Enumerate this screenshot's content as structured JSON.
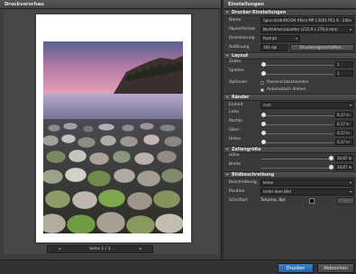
{
  "preview": {
    "title": "Druckvorschau",
    "pager": {
      "prev": "◂",
      "label": "Seite 1 / 1",
      "next": "▸"
    }
  },
  "settings": {
    "title": "Einstellungen",
    "printer_section": {
      "title": "Drucker-Einstellungen",
      "name_label": "Name",
      "name_value": "\\\\pcs-drsdr\\RICOH Aficio MP C3001 PCL 6 - 240",
      "paper_label": "Papierformat",
      "paper_value": "NorthAmericaLetter (215,9 x 279,4 mm)",
      "orientation_label": "Orientierung",
      "orientation_value": "Portrait",
      "resolution_label": "Auflösung",
      "resolution_value": "300 dpi",
      "properties_button": "Druckereigenschaften..."
    },
    "layout_section": {
      "title": "Layout",
      "rows_label": "Zeilen",
      "rows_value": "1",
      "cols_label": "Spalten",
      "cols_value": "1",
      "fit_label": "Optionen",
      "fit_checkbox": "Passend beschneiden",
      "auto_checkbox": "Automatisch drehen"
    },
    "margins_section": {
      "title": "Ränder",
      "unit_label": "Einheit",
      "unit_value": "inch",
      "left_label": "Links",
      "left_value": "0,17 in",
      "right_label": "Rechts",
      "right_value": "0,17 in",
      "top_label": "Oben",
      "top_value": "0,17 in",
      "bottom_label": "Unten",
      "bottom_value": "0,17 in"
    },
    "cell_section": {
      "title": "Zellengröße",
      "height_label": "Höhe",
      "height_value": "10,67 in",
      "width_label": "Breite",
      "width_value": "10,67 in"
    },
    "caption_section": {
      "title": "Bildbeschreibung",
      "desc_label": "Beschreibung",
      "desc_value": "keine",
      "pos_label": "Position",
      "pos_value": "Unter dem Bild",
      "font_label": "Schriftart",
      "font_value": "Tahoma, 8pt",
      "font_button": "..."
    }
  },
  "footer": {
    "print_button": "Drucken",
    "cancel_button": "Abbrechen"
  },
  "colors": {
    "accent": "#2f6fb8",
    "panel": "#3a3a3a",
    "paper": "#ffffff"
  }
}
